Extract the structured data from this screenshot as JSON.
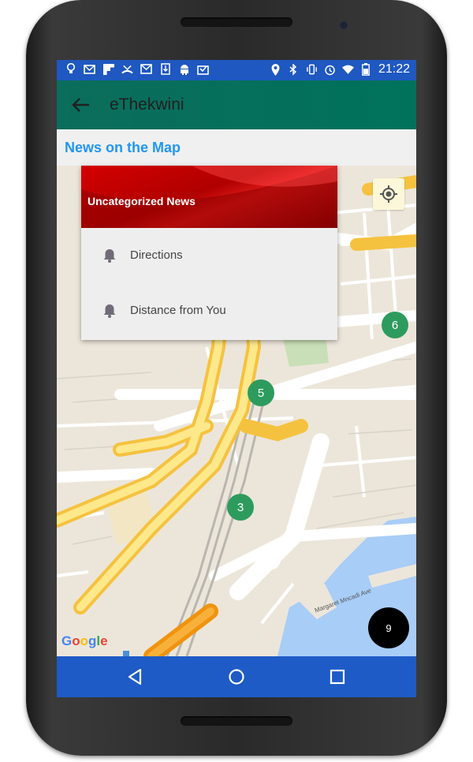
{
  "status_bar": {
    "time": "21:22",
    "left_icons": [
      "bulb-icon",
      "mail-icon",
      "flipboard-icon",
      "missed-call-icon",
      "gmail-icon",
      "download-icon",
      "android-icon",
      "inbox-icon"
    ],
    "right_icons": [
      "location-icon",
      "bluetooth-icon",
      "vibrate-icon",
      "alarm-icon",
      "wifi-icon",
      "battery-icon"
    ]
  },
  "app_bar": {
    "title": "eThekwini",
    "back_icon": "arrow-left-icon"
  },
  "section": {
    "title": "News on the Map"
  },
  "popup": {
    "title": "Uncategorized News",
    "items": [
      {
        "label": "Directions",
        "icon": "bell-icon"
      },
      {
        "label": "Distance from You",
        "icon": "bell-icon"
      }
    ]
  },
  "map": {
    "clusters": [
      {
        "count": "6"
      },
      {
        "count": "5"
      },
      {
        "count": "3"
      }
    ],
    "street_label": "Margaret Mncadi Ave",
    "attribution": "Google",
    "fab_count": "9"
  },
  "nav_bar": {
    "buttons": [
      "back-triangle-icon",
      "home-circle-icon",
      "recents-square-icon"
    ]
  },
  "colors": {
    "status_bar": "#1e58c0",
    "app_bar": "#00725c",
    "section_title": "#2196f3",
    "cluster": "#2e9b5e",
    "popup_header": "#c00000",
    "nav_bar": "#1e5bc6"
  }
}
